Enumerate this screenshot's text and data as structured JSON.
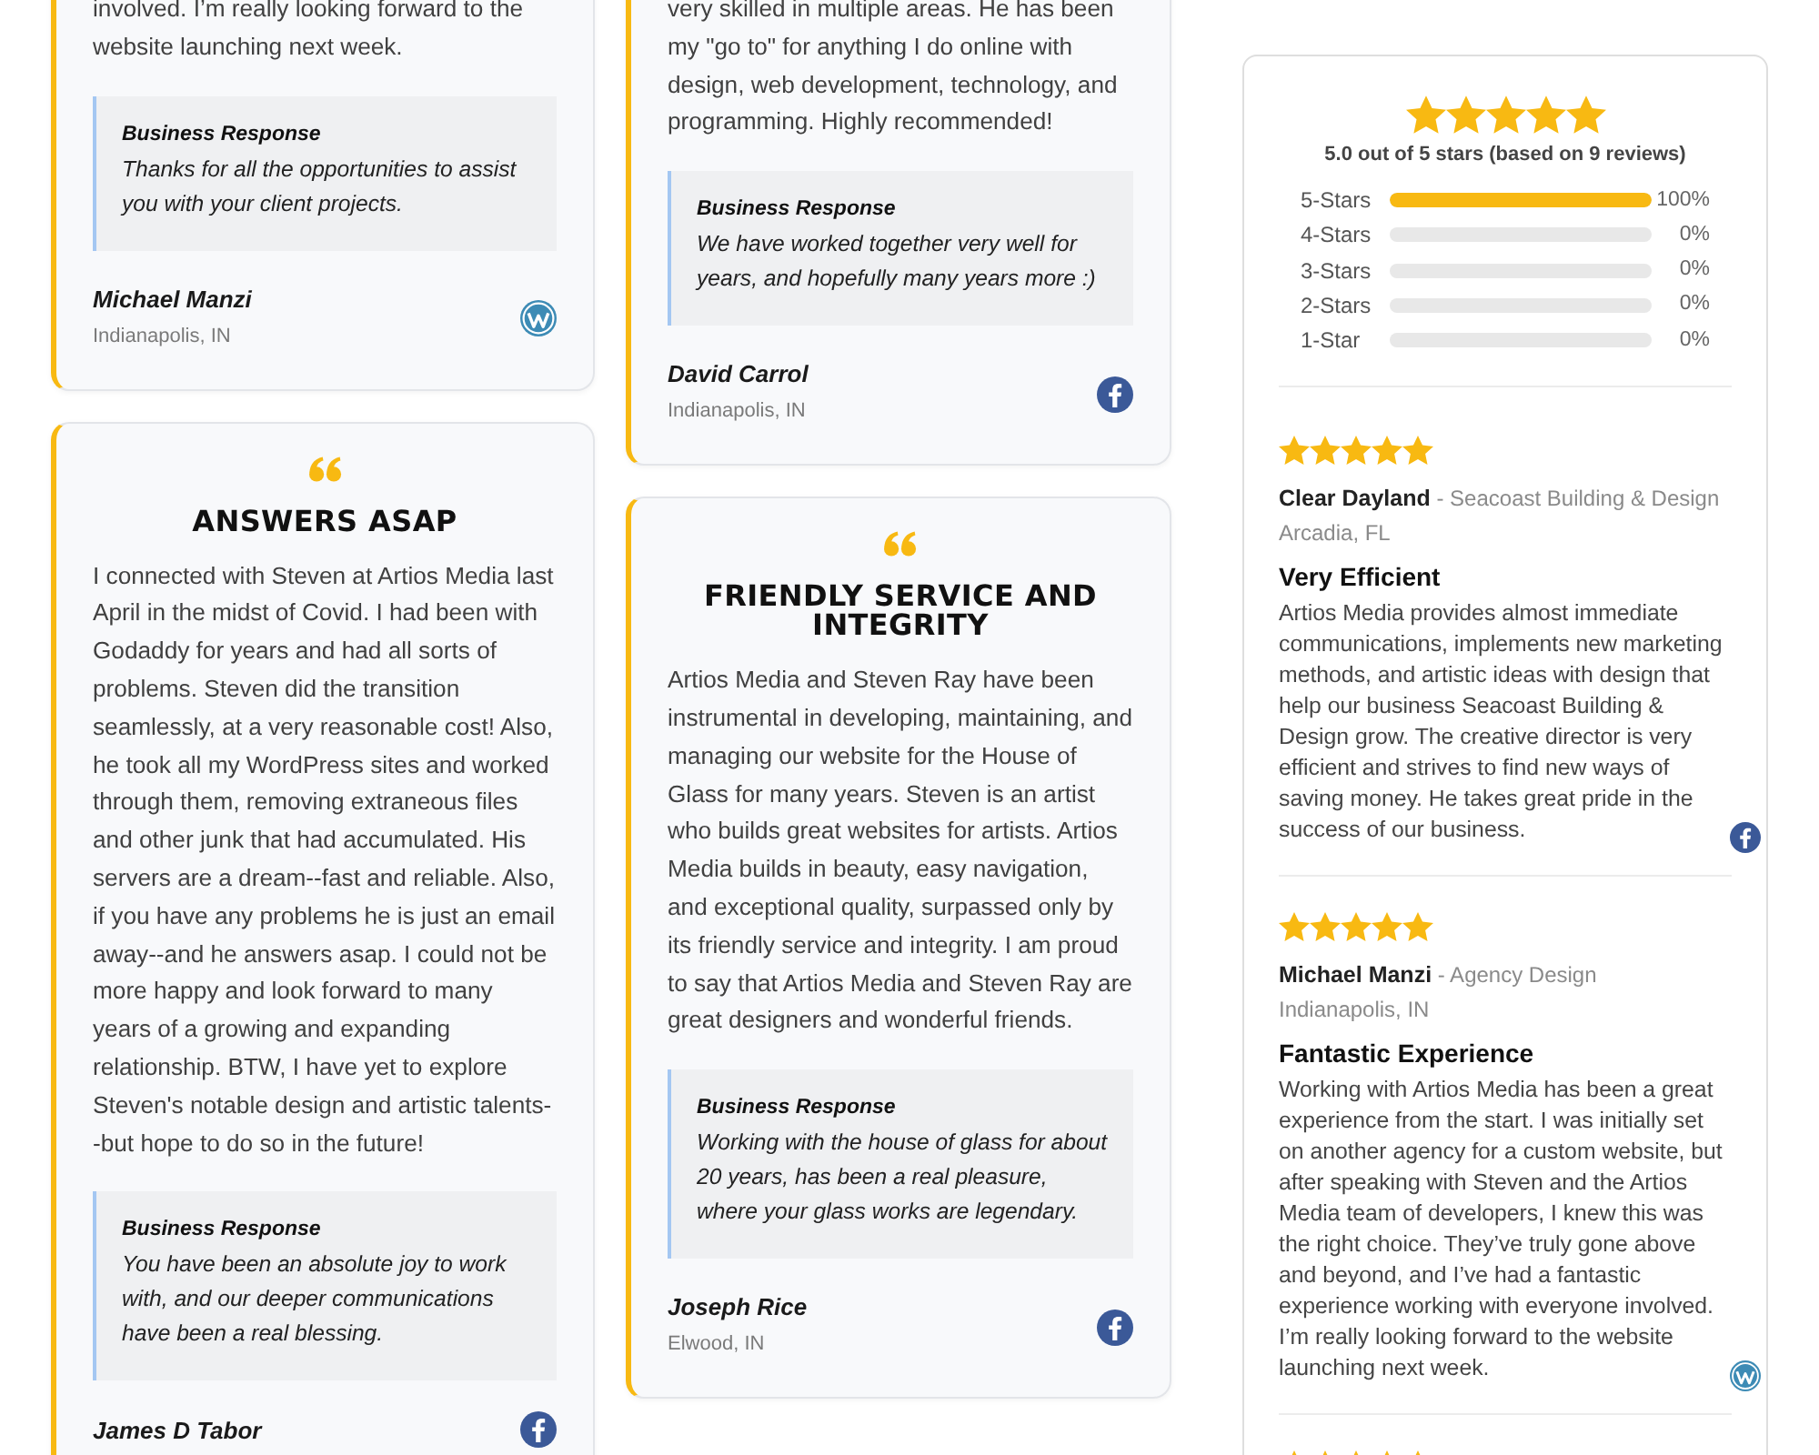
{
  "testimonial_columns": [
    {
      "cards": [
        {
          "body": "involved. I’m really looking forward to the website launching next week.",
          "response_title": "Business Response",
          "response": "Thanks for all the opportunities to assist you with your client projects.",
          "name": "Michael Manzi",
          "location": "Indianapolis, IN",
          "kind": "wordpress"
        },
        {
          "title": "ANSWERS ASAP",
          "body": "I connected with Steven at Artios Media last April in the midst of Covid. I had been with Godaddy for years and had all sorts of problems. Steven did the transition seamlessly, at a very reasonable cost! Also, he took all my WordPress sites and worked through them, removing extraneous files and other junk that had accumulated. His servers are a dream--fast and reliable. Also, if you have any problems he is just an email away--and he answers asap. I could not be more happy and look forward to many years of a growing and expanding relationship. BTW, I have yet to explore Steven's notable design and artistic talents--but hope to do so in the future!",
          "response_title": "Business Response",
          "response": "You have been an absolute joy to work with, and our deeper communications have been a real blessing.",
          "name": "James D Tabor",
          "kind": "facebook"
        }
      ]
    },
    {
      "cards": [
        {
          "body": "very skilled in multiple areas. He has been my \"go to\" for anything I do online with design, web development, technology, and programming. Highly recommended!",
          "response_title": "Business Response",
          "response": "We have worked together very well for years, and hopefully many years more :)",
          "name": "David Carrol",
          "location": "Indianapolis, IN",
          "kind": "facebook"
        },
        {
          "title": "FRIENDLY SERVICE AND INTEGRITY",
          "body": "Artios Media and Steven Ray have been instrumental in developing, maintaining, and managing our website for the House of Glass for many years. Steven is an artist who builds great websites for artists. Artios Media builds in beauty, easy navigation, and exceptional quality, surpassed only by its friendly service and integrity. I am proud to say that Artios Media and Steven Ray are great designers and wonderful friends.",
          "response_title": "Business Response",
          "response": "Working with the house of glass for about 20 years, has been a real pleasure, where your glass works are legendary.",
          "name": "Joseph Rice",
          "location": "Elwood, IN",
          "kind": "facebook"
        }
      ]
    }
  ],
  "rating_summary": {
    "stars": 5,
    "text": "5.0 out of 5 stars (based on 9 reviews)",
    "rows": [
      {
        "label": "5-Stars",
        "level": 1,
        "percent": "100%"
      },
      {
        "label": "4-Stars",
        "level": 0,
        "percent": "0%"
      },
      {
        "label": "3-Stars",
        "level": 0,
        "percent": "0%"
      },
      {
        "label": "2-Stars",
        "level": 0,
        "percent": "0%"
      },
      {
        "label": "1-Star",
        "level": 0,
        "percent": "0%"
      }
    ]
  },
  "reviews": [
    {
      "stars": 5,
      "name": "Clear Dayland",
      "company": "- Seacoast Building & Design",
      "location": "Arcadia, FL",
      "title": "Very Efficient",
      "body": "Artios Media provides almost immediate communications, implements new marketing methods, and artistic ideas with design that help our business Seacoast Building & Design grow. The creative director is very efficient and strives to find new ways of saving money. He takes great pride in the success of our business.",
      "kind": "facebook"
    },
    {
      "stars": 5,
      "name": "Michael Manzi",
      "company": "- Agency Design",
      "location": "Indianapolis, IN",
      "title": "Fantastic Experience",
      "body": "Working with Artios Media has been a great experience from the start. I was initially set on another agency for a custom website, but after speaking with Steven and the Artios Media team of developers, I knew this was the right choice. They’ve truly gone above and beyond, and I’ve had a fantastic experience working with everyone involved. I’m really looking forward to the website launching next week.",
      "kind": "wordpress"
    },
    {
      "stars": 5
    }
  ]
}
